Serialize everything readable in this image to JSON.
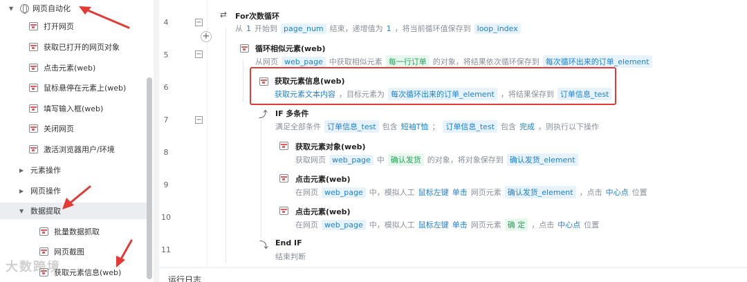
{
  "sidebar": {
    "root": {
      "label": "网页自动化"
    },
    "web_items": [
      {
        "label": "打开网页"
      },
      {
        "label": "获取已打开的网页对象"
      },
      {
        "label": "点击元素(web)"
      },
      {
        "label": "鼠标悬停在元素上(web)"
      },
      {
        "label": "填写输入框(web)"
      },
      {
        "label": "关闭网页"
      },
      {
        "label": "激活浏览器用户/环境"
      }
    ],
    "groups": [
      {
        "label": "元素操作"
      },
      {
        "label": "网页操作"
      },
      {
        "label": "数据提取"
      }
    ],
    "extract_items": [
      {
        "label": "批量数据抓取"
      },
      {
        "label": "网页截图"
      },
      {
        "label": "获取元素信息(web)"
      }
    ],
    "watermark": "大数跨境"
  },
  "editor": {
    "line_numbers": [
      "4",
      "5",
      "6",
      "7",
      "8",
      "9",
      "10",
      "11"
    ],
    "for_loop": {
      "title": "For次数循环",
      "d1": "从",
      "start": "1",
      "d2": "开始到",
      "end_var": "page_num",
      "d3": "结束，递增值为",
      "step": "1",
      "d4": "，将当前循环值保存到",
      "index_var": "loop_index"
    },
    "loop_similar": {
      "title": "循环相似元素(web)",
      "d1": "从网页",
      "page_var": "web_page",
      "d2": "中获取相似元素",
      "element": "每一行订单",
      "d3": "的对象，将结果依次循环保存到",
      "save_var": "每次循环出来的订单_element"
    },
    "get_info": {
      "title": "获取元素信息(web)",
      "d1": "获取元素文本内容",
      "d2": "，目标元素为",
      "target_var": "每次循环出来的订单_element",
      "d3": "，将结果保存到",
      "save_var": "订单信息_test"
    },
    "if_cond": {
      "title": "IF 多条件",
      "d1": "满足全部条件",
      "var1": "订单信息_test",
      "op1": "包含",
      "val1": "短袖T恤",
      "sep": "；",
      "var2": "订单信息_test",
      "op2": "包含",
      "val2": "完成",
      "d2": "，则执行以下操作"
    },
    "get_obj": {
      "title": "获取元素对象(web)",
      "d1": "获取网页",
      "page_var": "web_page",
      "d2": "中",
      "element": "确认发货",
      "d3": "的对象，将对象保存到",
      "save_var": "确认发货_element"
    },
    "click1": {
      "title": "点击元素(web)",
      "d1": "在网页",
      "page_var": "web_page",
      "d2": "中，模拟人工",
      "btn": "鼠标左键",
      "act": "单击",
      "d3": "网页元素",
      "element": "确认发货_element",
      "d4": "，点击",
      "pos": "中心点",
      "d5": "位置"
    },
    "click2": {
      "title": "点击元素(web)",
      "d1": "在网页",
      "page_var": "web_page",
      "d2": "中，模拟人工",
      "btn": "鼠标左键",
      "act": "单击",
      "d3": "网页元素",
      "element": "确 定",
      "d4": "，点击",
      "pos": "中心点",
      "d5": "位置"
    },
    "end_if": {
      "title": "End IF",
      "desc": "结束判断"
    }
  },
  "bottom": {
    "label": "运行日志"
  },
  "colors": {
    "accent": "#1e7fd0",
    "highlight": "#e53935",
    "arrow": "#e53935"
  }
}
